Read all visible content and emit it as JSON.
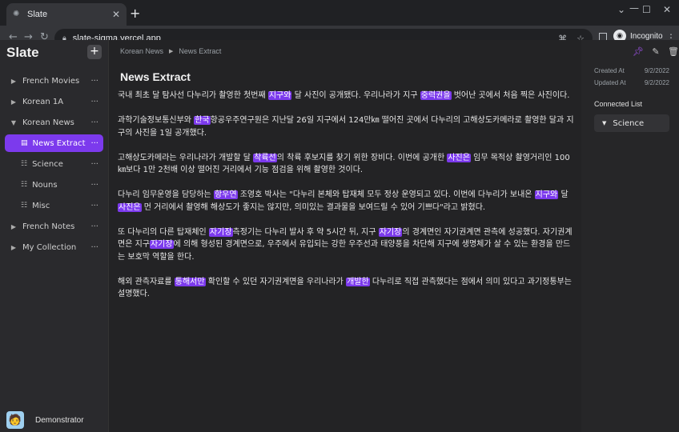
{
  "browser": {
    "tab_title": "Slate",
    "url": "slate-sigma.vercel.app",
    "profile_label": "Incognito"
  },
  "sidebar": {
    "brand": "Slate",
    "items": [
      {
        "label": "French Movies",
        "expanded": false,
        "child": false,
        "active": false
      },
      {
        "label": "Korean 1A",
        "expanded": false,
        "child": false,
        "active": false
      },
      {
        "label": "Korean News",
        "expanded": true,
        "child": false,
        "active": false
      },
      {
        "label": "News Extract",
        "child": true,
        "active": true
      },
      {
        "label": "Science",
        "child": true,
        "active": false
      },
      {
        "label": "Nouns",
        "child": true,
        "active": false
      },
      {
        "label": "Misc",
        "child": true,
        "active": false
      },
      {
        "label": "French Notes",
        "expanded": false,
        "child": false,
        "active": false
      },
      {
        "label": "My Collection",
        "expanded": false,
        "child": false,
        "active": false
      }
    ],
    "more_label": "···",
    "user_name": "Demonstrator"
  },
  "main": {
    "breadcrumb": [
      "Korean News",
      "News Extract"
    ],
    "title": "News Extract",
    "paragraphs": [
      [
        {
          "t": " 국내 최초 달 탐사선 다누리가 촬영한 첫번째 "
        },
        {
          "t": "지구와",
          "hl": true
        },
        {
          "t": " 달 사진이 공개됐다. 우리나라가 지구 "
        },
        {
          "t": "중력권을",
          "hl": true
        },
        {
          "t": " 벗어난 곳에서 처음 찍은 사진이다."
        }
      ],
      [
        {
          "t": "과학기술정보통신부와 "
        },
        {
          "t": "한국",
          "hl": true
        },
        {
          "t": "항공우주연구원은 지난달 26일 지구에서 124만㎞ 떨어진 곳에서 다누리의 고해상도카메라로 촬영한 달과 지구의 사진을 1일 공개했다."
        }
      ],
      [
        {
          "t": "고해상도카메라는 우리나라가 개발할 달 "
        },
        {
          "t": "착륙선",
          "hl": true
        },
        {
          "t": "의 착륙 후보지를 찾기 위한 장비다. 이번에 공개한 "
        },
        {
          "t": "사진은",
          "hl": true
        },
        {
          "t": " 임무 목적상 촬영거리인 100㎞보다 1만 2천배 이상 떨어진 거리에서 기능 점검을 위해 촬영한 것이다."
        }
      ],
      [
        {
          "t": "다누리 임무운영을 담당하는 "
        },
        {
          "t": "항우연",
          "hl": true
        },
        {
          "t": " 조영호 박사는 \"다누리 본체와 탑재체 모두 정상 운영되고 있다. 이번에 다누리가 보내온 "
        },
        {
          "t": "지구와",
          "hl": true
        },
        {
          "t": " 달 "
        },
        {
          "t": "사진은",
          "hl": true
        },
        {
          "t": " 먼 거리에서 촬영해 해상도가 좋지는 않지만, 의미있는 결과물을 보여드릴 수 있어 기쁘다\"라고 밝혔다."
        }
      ],
      [
        {
          "t": "또 다누리의 다른 탑재체인 "
        },
        {
          "t": "자기장",
          "hl": true
        },
        {
          "t": "측정기는 다누리 발사 후 약 5시간 뒤, 지구 "
        },
        {
          "t": "자기장",
          "hl": true
        },
        {
          "t": "의 경계면인 자기권계면 관측에 성공했다. 자기권계면은 지구"
        },
        {
          "t": "자기장",
          "hl": true
        },
        {
          "t": "에 의해 형성된 경계면으로, 우주에서 유입되는 강한 우주선과 태양풍을 차단해 지구에 생명체가 살 수 있는 환경을 만드는 보호막 역할을 한다."
        }
      ],
      [
        {
          "t": "해외 관측자료를 "
        },
        {
          "t": "통해서만",
          "hl": true
        },
        {
          "t": " 확인할 수 있던 자기권계면을 우리나라가 "
        },
        {
          "t": "개발한",
          "hl": true
        },
        {
          "t": " 다누리로 직접 관측했다는 점에서 의미 있다고 과기정통부는 설명했다."
        }
      ]
    ]
  },
  "details": {
    "created_label": "Created At",
    "created_value": "9/2/2022",
    "updated_label": "Updated At",
    "updated_value": "9/2/2022",
    "connected_title": "Connected List",
    "connected_items": [
      "Science"
    ]
  },
  "colors": {
    "accent": "#7c3aed",
    "pin": "#a855f7"
  }
}
